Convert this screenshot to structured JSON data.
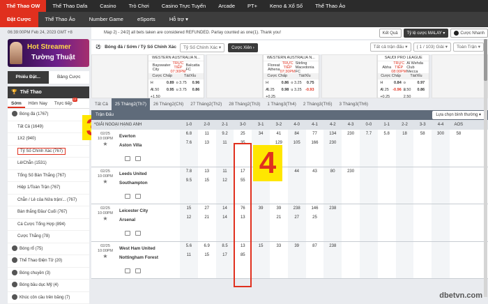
{
  "topnav": [
    "Thể Thao OW",
    "Thể Thao Dafa",
    "Casino",
    "Trò Chơi",
    "Casino Trực Tuyến",
    "Arcade",
    "PT+",
    "Keno & Xổ Số",
    "Thể Thao Ảo"
  ],
  "subnav": [
    "Đặt Cược",
    "Thể Thao Ảo",
    "Number Game",
    "eSports",
    "Hỗ trợ ▾"
  ],
  "sidebar": {
    "time": "06:39:00PM Feb 24, 2023 GMT +8",
    "banner_line1": "Hot Streamer",
    "banner_line2": "Tường Thuật",
    "tabs": [
      "Phiếu Đặt...",
      "Bảng Cược"
    ],
    "sport_header": "Thể Thao",
    "subtabs": [
      "Sớm",
      "Hôm Nay",
      "Trực tiếp"
    ],
    "live_badge": "12",
    "items": [
      {
        "label": "Bóng đá (1767)",
        "icon": true
      },
      {
        "label": "Tất Cả (1649)",
        "ind": true
      },
      {
        "label": "1X2 (940)",
        "ind": true
      },
      {
        "label": "Tỷ Số Chính Xác (767)",
        "ind": true,
        "hl": true
      },
      {
        "label": "Lẻ/Chẵn (1531)",
        "ind": true
      },
      {
        "label": "Tổng Số Bàn Thắng (767)",
        "ind": true
      },
      {
        "label": "Hiệp 1/Toàn Trận (767)",
        "ind": true
      },
      {
        "label": "Chẵn / Lẻ của Nửa trận/... (767)",
        "ind": true
      },
      {
        "label": "Bàn thắng Đầu/ Cuối (767)",
        "ind": true
      },
      {
        "label": "Cá Cược Tổng Hợp (894)",
        "ind": true
      },
      {
        "label": "Cược Thắng (78)",
        "ind": true
      },
      {
        "label": "Bóng rổ (75)",
        "icon": true
      },
      {
        "label": "Thể Thao Điện Tử (20)",
        "icon": true
      },
      {
        "label": "Bóng chuyền (3)",
        "icon": true
      },
      {
        "label": "Bóng bầu dục Mỹ (4)",
        "icon": true
      },
      {
        "label": "Khúc côn cầu trên băng (7)",
        "icon": true
      }
    ]
  },
  "overlay3": "3",
  "overlay4": "4",
  "notice": "Map 2) - 24/2] all bets taken are considered REFUNDED. Parlay counted as one(1). Thank you!",
  "notice_btns": [
    "Kết Quả",
    "Tỷ lệ cược MALAY ▾",
    "Cược Nhanh"
  ],
  "crumb": {
    "path": "Bóng đá / Sớm / Tỷ Số Chính Xác",
    "select": "Tỷ Số Chính Xác ▾",
    "button": "Cược Xiên  ›",
    "right": [
      "Tất cả trận đấu ▾",
      "( 1 / 103) Giải ▾",
      "Toàn Trận ▾"
    ]
  },
  "cards": [
    {
      "league": "WESTERN AUSTRALIA N...",
      "home": "Bayswater City",
      "away": "Balcatta FC",
      "live": "TRỰC TIẾP",
      "time": "07:30PM",
      "h1": "Cược Chấp",
      "h2": "Tài/Xỉu",
      "r1": [
        "H -1.50",
        "0.89",
        "o 3.75",
        "0.96"
      ],
      "r2": [
        "A +1.50",
        "0.95",
        "u 3.75",
        "0.86"
      ],
      "neg": []
    },
    {
      "league": "WESTERN AUSTRALIA N...",
      "home": "Floreat Athena",
      "away": "Stirling Macedonia FC",
      "live": "TRỰC TIẾP",
      "time": "07:30PM",
      "h1": "Cược Chấp",
      "h2": "Tài/Xỉu",
      "r1": [
        "H -0.25",
        "0.86",
        "o 3.25",
        "0.75"
      ],
      "r2": [
        "A +0.25",
        "0.98",
        "u 3.25",
        "-0.93"
      ],
      "neg": [
        3
      ]
    },
    {
      "league": "SAUDI PRO LEAGUE",
      "home": "Abha",
      "away": "Al Wehda Club Mecca",
      "live": "TRỰC TIẾP",
      "time": "08:00PM",
      "h1": "Cược Chấp",
      "h2": "Tài/Xỉu",
      "r1": [
        "H -0.25",
        "0.84",
        "o 2.50",
        "0.97"
      ],
      "r2": [
        "A +0.25",
        "-0.96",
        "u 2.50",
        "0.86"
      ],
      "neg": [
        1
      ]
    }
  ],
  "tabs2": [
    "Tất Cả",
    "25 Tháng2(Th7)",
    "26 Tháng2(CN)",
    "27 Tháng2(Th2)",
    "28 Tháng2(Th3)",
    "1 Tháng3(Th4)",
    "2 Tháng3(Th5)",
    "3 Tháng3(Th6)"
  ],
  "table_bar": "Trận Đấu",
  "sort": "Lựa chọn bình thường ▾",
  "league": "*GIẢI NGOẠI HẠNG ANH",
  "cols": [
    "1-0",
    "2-0",
    "2-1",
    "3-0",
    "3-1",
    "3-2",
    "4-0",
    "4-1",
    "4-2",
    "4-3",
    "0-0",
    "1-1",
    "2-2",
    "3-3",
    "4-4",
    "AOS"
  ],
  "matches": [
    {
      "date": "02/25",
      "time": "10:00PM",
      "home": "Everton",
      "away": "Aston Villa",
      "r1": [
        "6.8",
        "11",
        "9.2",
        "25",
        "34",
        "41",
        "84",
        "77",
        "134",
        "230",
        "7.7",
        "5.8",
        "18",
        "58",
        "300",
        "58"
      ],
      "r2": [
        "7.6",
        "13",
        "11",
        "35",
        "",
        "129",
        "105",
        "166",
        "230",
        "",
        ""
      ]
    },
    {
      "date": "02/25",
      "time": "10:00PM",
      "home": "Leeds United",
      "away": "Southampton",
      "r1": [
        "7.8",
        "13",
        "11",
        "17",
        "36",
        "30",
        "44",
        "43",
        "80",
        "230",
        "",
        "",
        "",
        "",
        "",
        ""
      ],
      "r2": [
        "9.5",
        "15",
        "12",
        "55",
        "",
        "",
        "",
        "",
        "",
        "",
        ""
      ]
    },
    {
      "date": "02/25",
      "time": "10:00PM",
      "home": "Leicester City",
      "away": "Arsenal",
      "r1": [
        "15",
        "27",
        "14",
        "76",
        "39",
        "39",
        "238",
        "146",
        "238",
        "",
        "",
        "",
        "",
        "",
        "",
        ""
      ],
      "r2": [
        "12",
        "21",
        "14",
        "13",
        "",
        "21",
        "27",
        "25",
        "",
        "",
        ""
      ]
    },
    {
      "date": "02/25",
      "time": "10:00PM",
      "home": "West Ham United",
      "away": "Nottingham Forest",
      "r1": [
        "5.6",
        "6.9",
        "8.5",
        "13",
        "15",
        "33",
        "39",
        "87",
        "238",
        "",
        "",
        "",
        "",
        "",
        "",
        ""
      ],
      "r2": [
        "11",
        "15",
        "17",
        "85",
        "",
        "",
        "",
        "",
        "",
        "",
        ""
      ]
    }
  ],
  "watermark": "dbetvn.com"
}
